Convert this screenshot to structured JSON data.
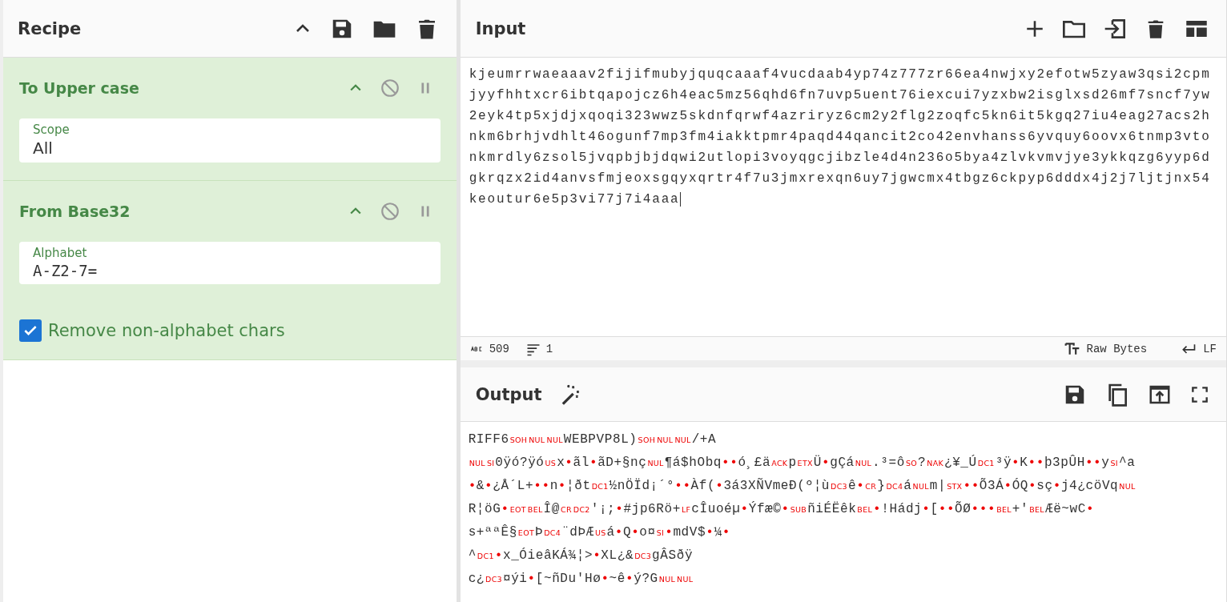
{
  "recipe": {
    "title": "Recipe"
  },
  "operations": [
    {
      "name": "To Upper case",
      "args": [
        {
          "kind": "field",
          "label": "Scope",
          "value": "All"
        }
      ]
    },
    {
      "name": "From Base32",
      "args": [
        {
          "kind": "field",
          "label": "Alphabet",
          "value": "A-Z2-7="
        },
        {
          "kind": "checkbox",
          "label": "Remove non-alphabet chars",
          "checked": true
        }
      ]
    }
  ],
  "input": {
    "title": "Input",
    "text": "kjeumrrwaeaaav2fijifmubyjquqcaaaf4vucdaab4yp74z777zr66ea4nwjxy2efotw5zyaw3qsi2cpmjyyfhhtxcr6ibtqapojcz6h4eac5mz56qhd6fn7uvp5uent76iexcui7yzxbw2isglxsd26mf7sncf7yw2eyk4tp5xjdjxqoqi323wwz5skdnfqrwf4azriryz6cm2y2flg2zoqfc5kn6it5kgq27iu4eag27acs2hnkm6brhjvdhlt46ogunf7mp3fm4iakktpmr4paqd44qancit2co42envhanss6yvquy6oovx6tnmp3vtonkmrdly6zsol5jvqpbjbjdqwi2utlopi3voyqgcjibzle4d4n236o5bya4zlvkvmvjye3ykkqzg6yyp6dgkrqzx2id4anvsfmjeoxsgqyxqrtr4f7u3jmxrexqn6uy7jgwcmx4tbgz6ckpyp6dddx4j2j7ljtjnx54keoutur6e5p3vi77j7i4aaa",
    "length": "509",
    "lines": "1",
    "encoding": "Raw Bytes",
    "eol": "LF"
  },
  "output": {
    "title": "Output",
    "lines": [
      [
        {
          "kind": "text",
          "text": "RIFF6"
        },
        {
          "kind": "ctrl",
          "text": "SOH"
        },
        {
          "kind": "ctrl",
          "text": "NUL"
        },
        {
          "kind": "ctrl",
          "text": "NUL"
        },
        {
          "kind": "text",
          "text": "WEBPVP8L)"
        },
        {
          "kind": "ctrl",
          "text": "SOH"
        },
        {
          "kind": "ctrl",
          "text": "NUL"
        },
        {
          "kind": "ctrl",
          "text": "NUL"
        },
        {
          "kind": "text",
          "text": "/+A"
        }
      ],
      [
        {
          "kind": "ctrl",
          "text": "NUL"
        },
        {
          "kind": "ctrl",
          "text": "SI"
        },
        {
          "kind": "text",
          "text": "0ÿó?ÿó"
        },
        {
          "kind": "ctrl",
          "text": "US"
        },
        {
          "kind": "text",
          "text": "x"
        },
        {
          "kind": "dot",
          "text": "•"
        },
        {
          "kind": "text",
          "text": "ãl"
        },
        {
          "kind": "dot",
          "text": "•"
        },
        {
          "kind": "text",
          "text": "ãD+§nç"
        },
        {
          "kind": "ctrl",
          "text": "NUL"
        },
        {
          "kind": "text",
          "text": "¶á$hObq"
        },
        {
          "kind": "dot",
          "text": "••"
        },
        {
          "kind": "text",
          "text": "ó¸£ä"
        },
        {
          "kind": "ctrl",
          "text": "ACK"
        },
        {
          "kind": "text",
          "text": "p"
        },
        {
          "kind": "ctrl",
          "text": "ETX"
        },
        {
          "kind": "text",
          "text": "Ü"
        },
        {
          "kind": "dot",
          "text": "•"
        },
        {
          "kind": "text",
          "text": "gÇá"
        },
        {
          "kind": "ctrl",
          "text": "NUL"
        },
        {
          "kind": "text",
          "text": ".³=ô"
        },
        {
          "kind": "ctrl",
          "text": "SO"
        },
        {
          "kind": "text",
          "text": "?"
        },
        {
          "kind": "ctrl",
          "text": "NAK"
        },
        {
          "kind": "text",
          "text": "¿¥_Ú"
        },
        {
          "kind": "ctrl",
          "text": "DC1"
        },
        {
          "kind": "text",
          "text": "³ÿ"
        },
        {
          "kind": "dot",
          "text": "•"
        },
        {
          "kind": "text",
          "text": "K"
        },
        {
          "kind": "dot",
          "text": "••"
        },
        {
          "kind": "text",
          "text": "þ3pÛH"
        },
        {
          "kind": "dot",
          "text": "••"
        },
        {
          "kind": "text",
          "text": "y"
        },
        {
          "kind": "ctrl",
          "text": "SI"
        },
        {
          "kind": "text",
          "text": "^a"
        }
      ],
      [
        {
          "kind": "dot",
          "text": "•"
        },
        {
          "kind": "text",
          "text": "&"
        },
        {
          "kind": "dot",
          "text": "•"
        },
        {
          "kind": "text",
          "text": "¿Å´L+"
        },
        {
          "kind": "dot",
          "text": "••"
        },
        {
          "kind": "text",
          "text": "n"
        },
        {
          "kind": "dot",
          "text": "•"
        },
        {
          "kind": "text",
          "text": "¦ðt"
        },
        {
          "kind": "ctrl",
          "text": "DC1"
        },
        {
          "kind": "text",
          "text": "½nÖÏd¡´°"
        },
        {
          "kind": "dot",
          "text": "••"
        },
        {
          "kind": "text",
          "text": "Àf("
        },
        {
          "kind": "dot",
          "text": "•"
        },
        {
          "kind": "text",
          "text": "3á3XÑVmeÐ(º¦ù"
        },
        {
          "kind": "ctrl",
          "text": "DC3"
        },
        {
          "kind": "text",
          "text": "ê"
        },
        {
          "kind": "dot",
          "text": "•"
        },
        {
          "kind": "ctrl",
          "text": "CR"
        },
        {
          "kind": "text",
          "text": "}"
        },
        {
          "kind": "ctrl",
          "text": "DC4"
        },
        {
          "kind": "text",
          "text": "á"
        },
        {
          "kind": "ctrl",
          "text": "NUL"
        },
        {
          "kind": "text",
          "text": "m|"
        },
        {
          "kind": "ctrl",
          "text": "STX"
        },
        {
          "kind": "dot",
          "text": "••"
        },
        {
          "kind": "text",
          "text": "Õ3Á"
        },
        {
          "kind": "dot",
          "text": "•"
        },
        {
          "kind": "text",
          "text": "ÓQ"
        },
        {
          "kind": "dot",
          "text": "•"
        },
        {
          "kind": "text",
          "text": "sç"
        },
        {
          "kind": "dot",
          "text": "•"
        },
        {
          "kind": "text",
          "text": "j4¿cöVq"
        },
        {
          "kind": "ctrl",
          "text": "NUL"
        }
      ],
      [
        {
          "kind": "text",
          "text": "R¦öG"
        },
        {
          "kind": "dot",
          "text": "•"
        },
        {
          "kind": "ctrl",
          "text": "EOT"
        },
        {
          "kind": "ctrl",
          "text": "BEL"
        },
        {
          "kind": "text",
          "text": "Î@"
        },
        {
          "kind": "ctrl",
          "text": "CR"
        },
        {
          "kind": "ctrl",
          "text": "DC2"
        },
        {
          "kind": "text",
          "text": "'¡;"
        },
        {
          "kind": "dot",
          "text": "•"
        },
        {
          "kind": "text",
          "text": "#jp6Rö+"
        },
        {
          "kind": "ctrl",
          "text": "LF"
        },
        {
          "kind": "text",
          "text": "cÎuoéµ"
        },
        {
          "kind": "dot",
          "text": "•"
        },
        {
          "kind": "text",
          "text": "Ýfæ©"
        },
        {
          "kind": "dot",
          "text": "•"
        },
        {
          "kind": "ctrl",
          "text": "SUB"
        },
        {
          "kind": "text",
          "text": "ñiÉËêk"
        },
        {
          "kind": "ctrl",
          "text": "BEL"
        },
        {
          "kind": "dot",
          "text": "•"
        },
        {
          "kind": "text",
          "text": "!Hádj"
        },
        {
          "kind": "dot",
          "text": "•"
        },
        {
          "kind": "text",
          "text": "["
        },
        {
          "kind": "dot",
          "text": "••"
        },
        {
          "kind": "text",
          "text": "ÕØ"
        },
        {
          "kind": "dot",
          "text": "•••"
        },
        {
          "kind": "ctrl",
          "text": "BEL"
        },
        {
          "kind": "text",
          "text": "+'"
        },
        {
          "kind": "ctrl",
          "text": "BEL"
        },
        {
          "kind": "text",
          "text": "Æë~wC"
        },
        {
          "kind": "dot",
          "text": "•"
        }
      ],
      [
        {
          "kind": "text",
          "text": "s+ªªÊ§"
        },
        {
          "kind": "ctrl",
          "text": "EOT"
        },
        {
          "kind": "text",
          "text": "Þ"
        },
        {
          "kind": "ctrl",
          "text": "DC4"
        },
        {
          "kind": "text",
          "text": "¨dÞÆ"
        },
        {
          "kind": "ctrl",
          "text": "US"
        },
        {
          "kind": "text",
          "text": "á"
        },
        {
          "kind": "dot",
          "text": "•"
        },
        {
          "kind": "text",
          "text": "Q"
        },
        {
          "kind": "dot",
          "text": "•"
        },
        {
          "kind": "text",
          "text": "o¤"
        },
        {
          "kind": "ctrl",
          "text": "SI"
        },
        {
          "kind": "dot",
          "text": "•"
        },
        {
          "kind": "text",
          "text": "mdV$"
        },
        {
          "kind": "dot",
          "text": "•"
        },
        {
          "kind": "text",
          "text": "¼"
        },
        {
          "kind": "dot",
          "text": "•"
        }
      ],
      [
        {
          "kind": "text",
          "text": "^"
        },
        {
          "kind": "ctrl",
          "text": "DC1"
        },
        {
          "kind": "dot",
          "text": "•"
        },
        {
          "kind": "text",
          "text": "x_ÓieâKÁ¾¦>"
        },
        {
          "kind": "dot",
          "text": "•"
        },
        {
          "kind": "text",
          "text": "XL¿&"
        },
        {
          "kind": "ctrl",
          "text": "DC3"
        },
        {
          "kind": "text",
          "text": "gÂSðÿ"
        }
      ],
      [
        {
          "kind": "text",
          "text": "c¿"
        },
        {
          "kind": "ctrl",
          "text": "DC3"
        },
        {
          "kind": "text",
          "text": "¤ýi"
        },
        {
          "kind": "dot",
          "text": "•"
        },
        {
          "kind": "text",
          "text": "[~ñDu'Hø"
        },
        {
          "kind": "dot",
          "text": "•"
        },
        {
          "kind": "text",
          "text": "~ê"
        },
        {
          "kind": "dot",
          "text": "•"
        },
        {
          "kind": "text",
          "text": "ý?G"
        },
        {
          "kind": "ctrl",
          "text": "NUL"
        },
        {
          "kind": "ctrl",
          "text": "NUL"
        }
      ]
    ]
  }
}
